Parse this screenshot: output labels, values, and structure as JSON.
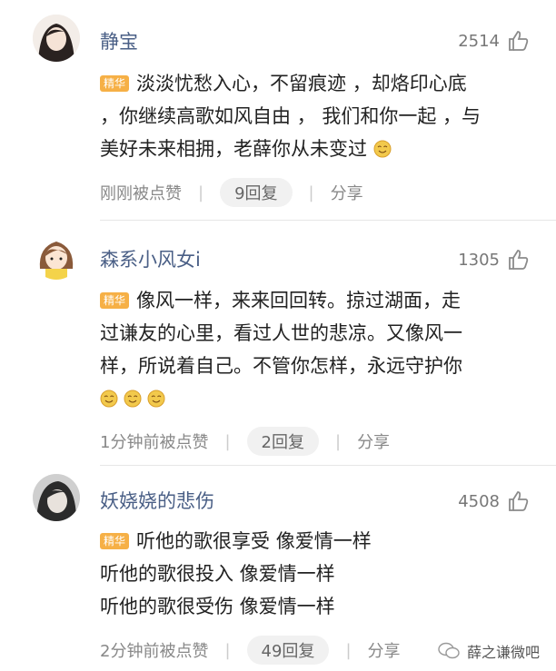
{
  "comments": [
    {
      "username": "静宝",
      "likes": "2514",
      "badge": "精华",
      "lines": [
        "淡淡忧愁入心，不留痕迹 ，却烙印心底",
        "，你继续高歌如风自由 ， 我们和你一起 ，与",
        "美好未来相拥，老薛你从未变过"
      ],
      "time": "刚刚被点赞",
      "replies": "9回复",
      "share": "分享"
    },
    {
      "username": "森系小风女i",
      "likes": "1305",
      "badge": "精华",
      "lines": [
        "像风一样，来来回回转。掠过湖面，走",
        "过谦友的心里，看过人世的悲凉。又像风一",
        "样，所说着自己。不管你怎样，永远守护你"
      ],
      "time": "1分钟前被点赞",
      "replies": "2回复",
      "share": "分享"
    },
    {
      "username": "妖娆娆的悲伤",
      "likes": "4508",
      "badge": "精华",
      "lines": [
        "听他的歌很享受 像爱情一样",
        "听他的歌很投入 像爱情一样",
        "听他的歌很受伤 像爱情一样"
      ],
      "time": "2分钟前被点赞",
      "replies": "49回复",
      "share": "分享"
    }
  ],
  "watermark": "薛之谦微吧",
  "colors": {
    "username": "#4a5f86",
    "badge": "#f6b046",
    "emoji": "#f2c94c"
  }
}
